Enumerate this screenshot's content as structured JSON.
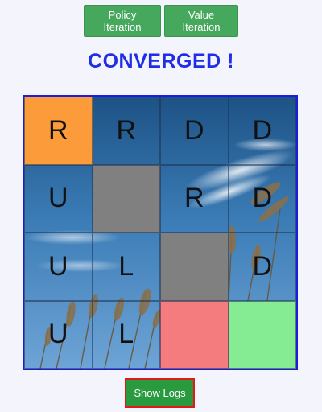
{
  "buttons": {
    "policy_iteration": "Policy Iteration",
    "value_iteration": "Value Iteration",
    "show_logs": "Show Logs"
  },
  "status": "CONVERGED !",
  "colors": {
    "button_green": "#45a85c",
    "status_blue": "#1f2ee6",
    "board_border": "#1c1ce0",
    "start": "#fb9b3a",
    "wall": "#808080",
    "pit": "#f47b7e",
    "goal": "#86ec93",
    "logs_border": "#e01919"
  },
  "grid": {
    "rows": [
      [
        {
          "type": "start",
          "action": "R"
        },
        {
          "type": "open",
          "action": "R"
        },
        {
          "type": "open",
          "action": "D"
        },
        {
          "type": "open",
          "action": "D"
        }
      ],
      [
        {
          "type": "open",
          "action": "U"
        },
        {
          "type": "wall",
          "action": ""
        },
        {
          "type": "open",
          "action": "R"
        },
        {
          "type": "open",
          "action": "D"
        }
      ],
      [
        {
          "type": "open",
          "action": "U"
        },
        {
          "type": "open",
          "action": "L"
        },
        {
          "type": "wall",
          "action": ""
        },
        {
          "type": "open",
          "action": "D"
        }
      ],
      [
        {
          "type": "open",
          "action": "U"
        },
        {
          "type": "open",
          "action": "L"
        },
        {
          "type": "pit",
          "action": ""
        },
        {
          "type": "goal",
          "action": ""
        }
      ]
    ]
  }
}
